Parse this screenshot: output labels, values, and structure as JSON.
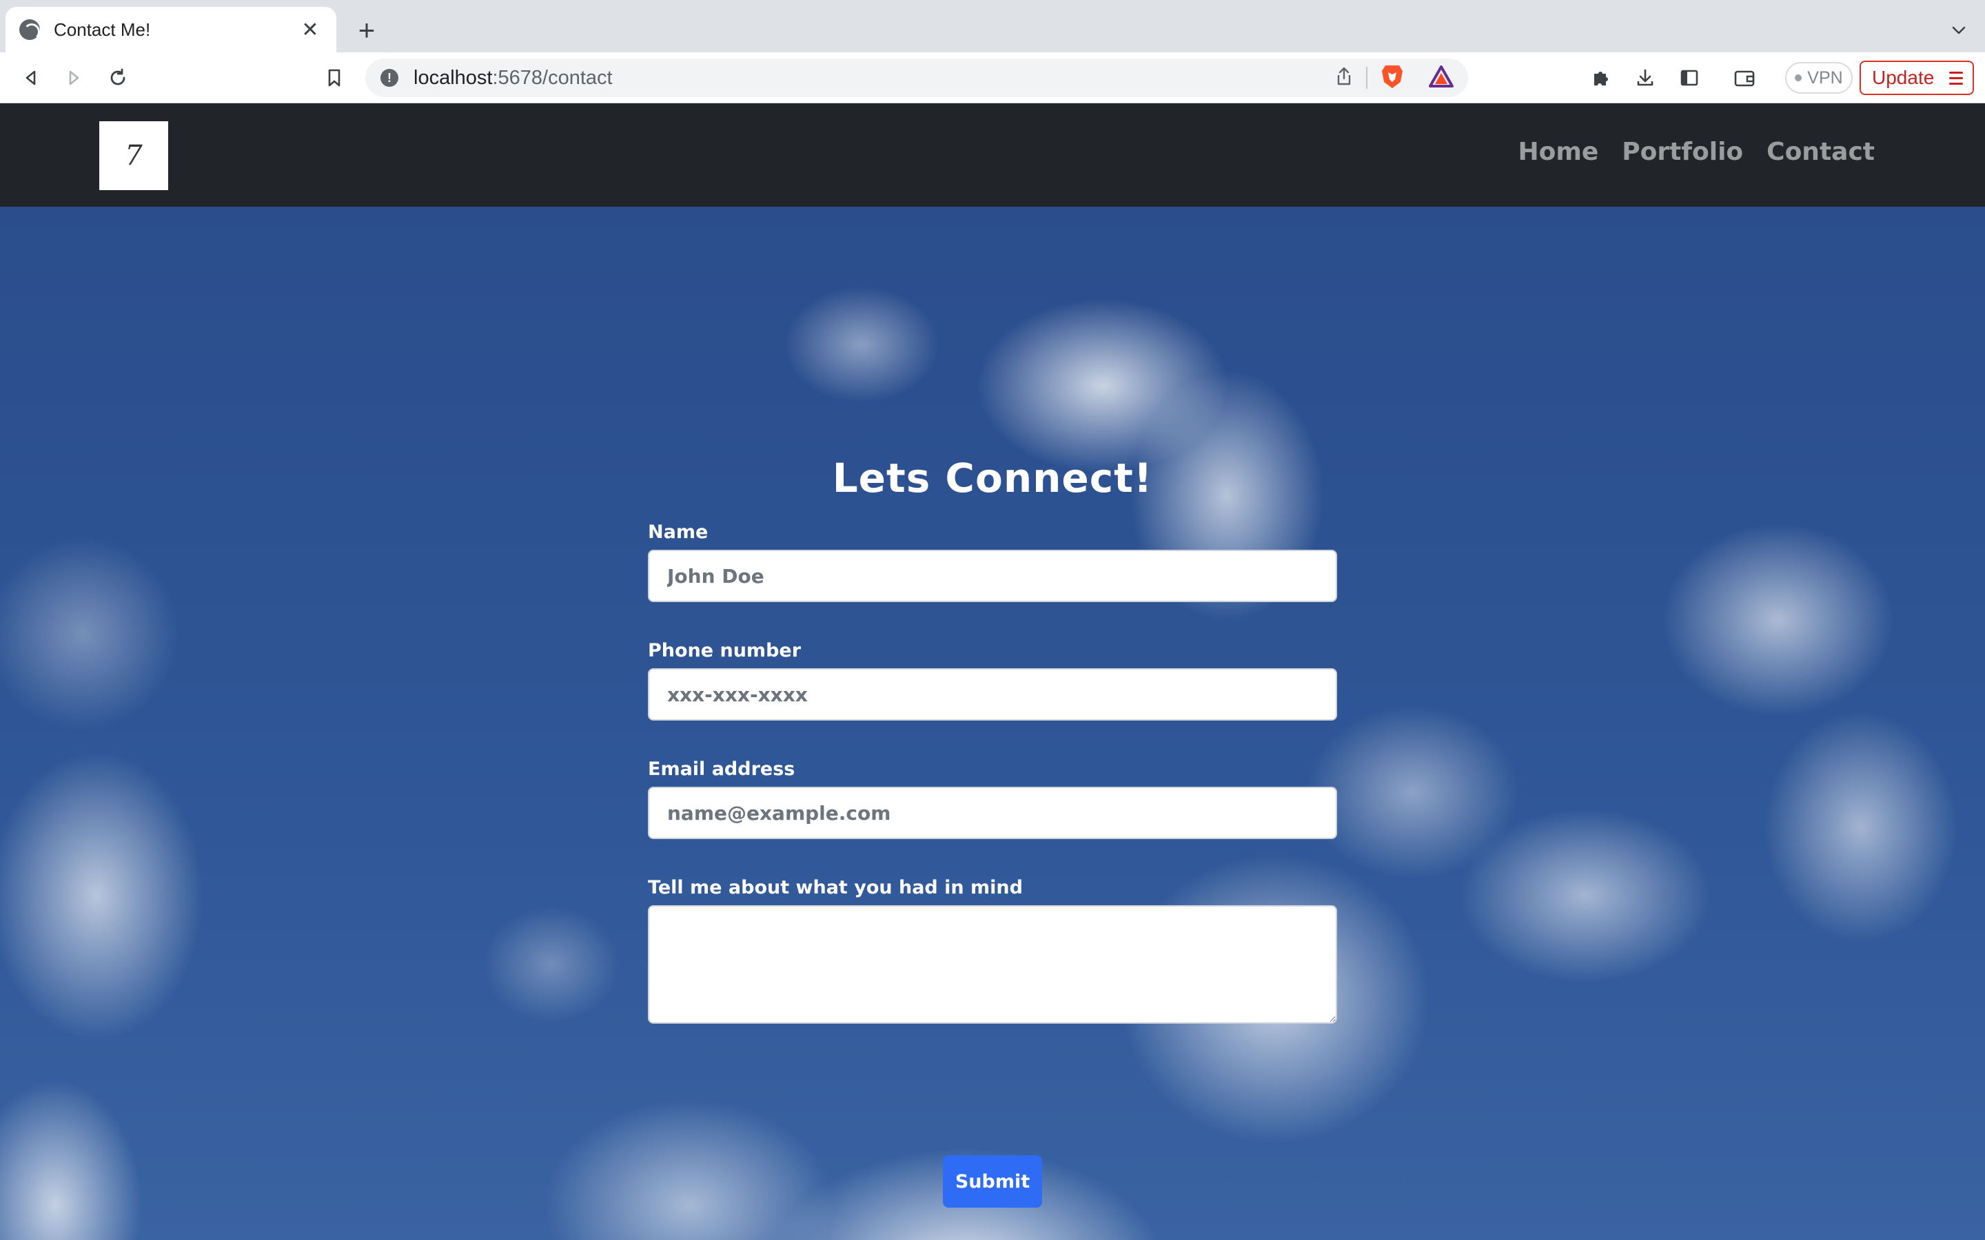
{
  "browser": {
    "tab_title": "Contact Me!",
    "tab_close": "✕",
    "new_tab": "+",
    "url_host": "localhost",
    "url_path": ":5678/contact",
    "vpn_label": "VPN",
    "update_label": "Update"
  },
  "nav": {
    "brand": "7",
    "links": [
      "Home",
      "Portfolio",
      "Contact"
    ]
  },
  "form": {
    "title": "Lets Connect!",
    "name_label": "Name",
    "name_placeholder": "John Doe",
    "phone_label": "Phone number",
    "phone_placeholder": "xxx-xxx-xxxx",
    "email_label": "Email address",
    "email_placeholder": "name@example.com",
    "message_label": "Tell me about what you had in mind",
    "submit_label": "Submit"
  },
  "colors": {
    "navbar": "#212529",
    "sky": "#2c4f8a",
    "submit": "#2f6cf6",
    "update_accent": "#d93025"
  }
}
